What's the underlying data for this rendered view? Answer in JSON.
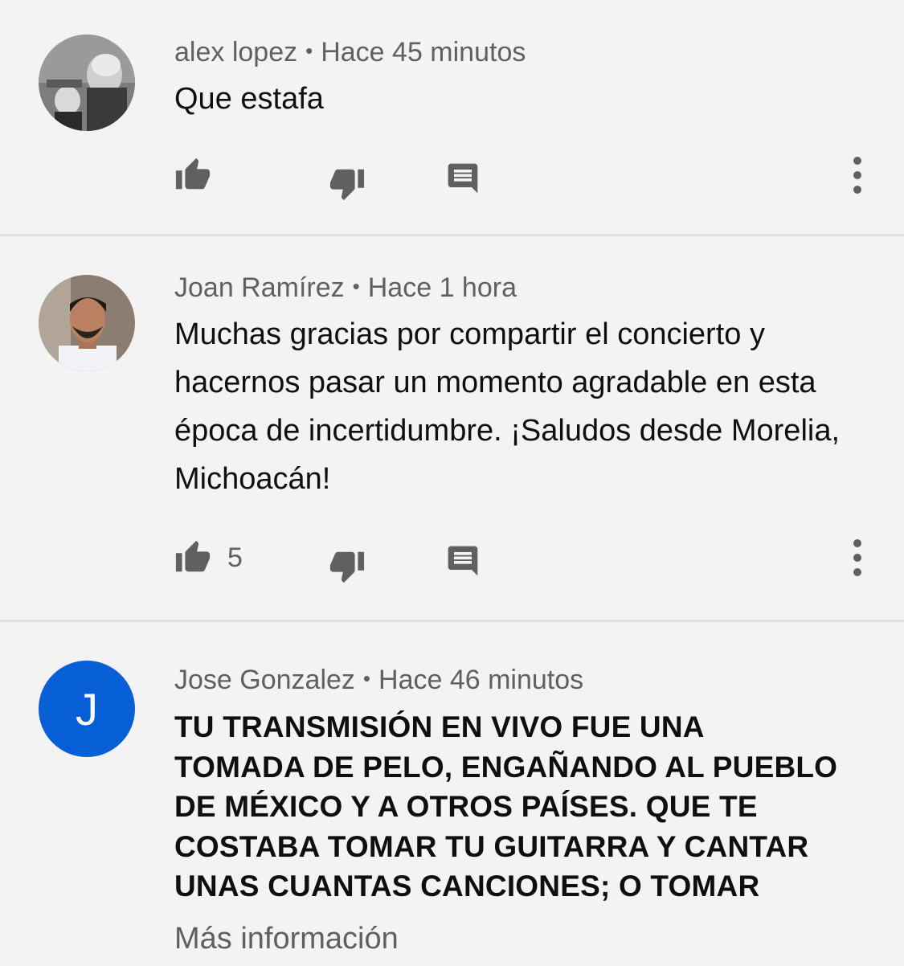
{
  "comments": [
    {
      "author": "alex lopez",
      "separator": "•",
      "time": "Hace 45 minutos",
      "text": "Que estafa",
      "likes": "",
      "avatar": "photo"
    },
    {
      "author": "Joan Ramírez",
      "separator": "•",
      "time": "Hace 1 hora",
      "text": "Muchas gracias por compartir el concierto y hacernos pasar un momento agradable en esta época de incertidumbre. ¡Saludos desde Morelia, Michoacán!",
      "likes": "5",
      "avatar": "photo"
    },
    {
      "author": "Jose Gonzalez",
      "separator": "•",
      "time": "Hace 46 minutos",
      "avatar_letter": "J",
      "avatar_color": "#065fd4",
      "text_lines": [
        "TU TRANSMISIÓN EN VIVO FUE UNA",
        "TOMADA DE PELO, ENGAÑANDO AL PUEBLO",
        "DE MÉXICO Y A OTROS PAÍSES. QUE TE",
        "COSTABA TOMAR TU GUITARRA Y CANTAR",
        "UNAS CUANTAS CANCIONES; O TOMAR"
      ],
      "more_label": "Más información"
    }
  ],
  "icons": {
    "like": "thumb-up-icon",
    "dislike": "thumb-down-icon",
    "reply": "comment-icon",
    "menu": "more-vertical-icon"
  }
}
